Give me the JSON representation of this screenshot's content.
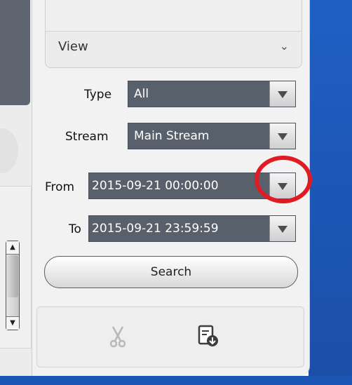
{
  "view_section": {
    "label": "View"
  },
  "filters": {
    "type": {
      "label": "Type",
      "value": "All"
    },
    "stream": {
      "label": "Stream",
      "value": "Main Stream"
    },
    "from": {
      "label": "From",
      "value": "2015-09-21 00:00:00"
    },
    "to": {
      "label": "To",
      "value": "2015-09-21 23:59:59"
    }
  },
  "search": {
    "label": "Search"
  },
  "tools": [
    {
      "icon": "scissors-icon",
      "state": "disabled"
    },
    {
      "icon": "download-record-icon",
      "state": "enabled"
    }
  ],
  "colors": {
    "combo_background": "#58606c",
    "highlight": "#e01b24",
    "desktop": "#1f5fc4"
  }
}
